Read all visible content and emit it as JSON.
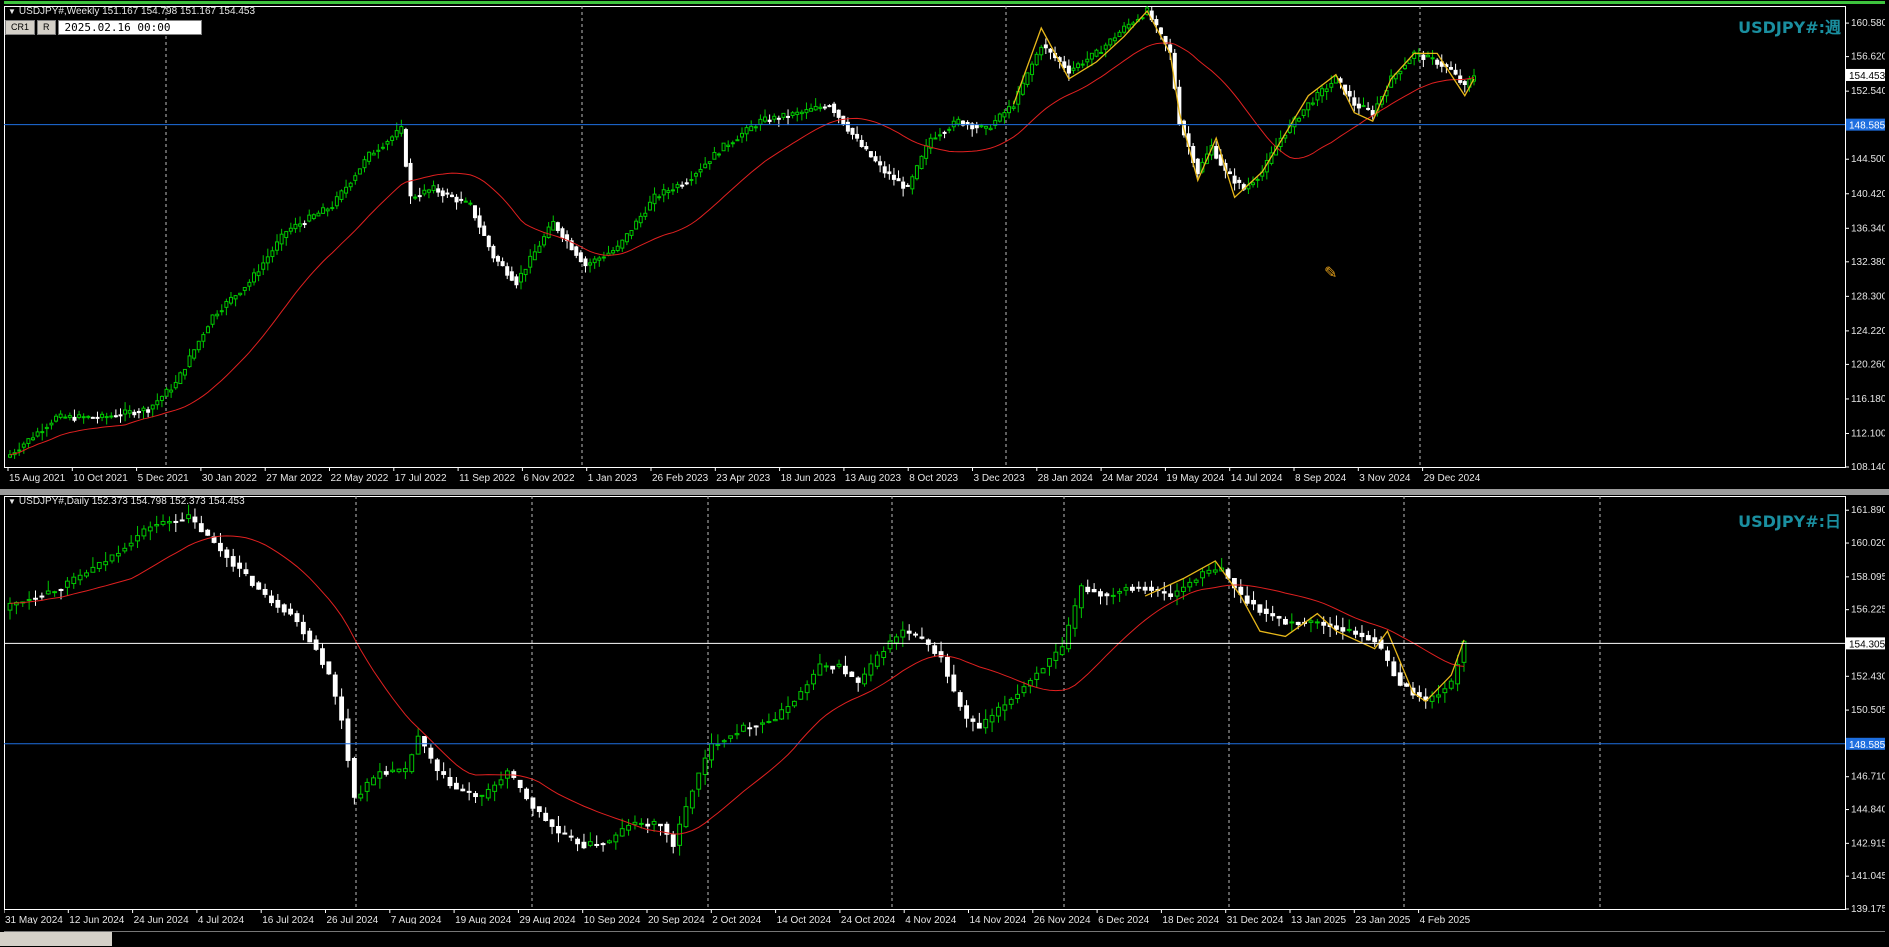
{
  "weekly": {
    "info": "USDJPY#,Weekly  151.167 154.798 151.167 154.453",
    "symbol_label": "USDJPY#:週",
    "toolbar": {
      "cr_button": "CR1",
      "r_button": "R",
      "date_value": "2025.02.16 00:00"
    },
    "price_current": "154.453",
    "price_line": "148.585",
    "colors": {
      "bull": "#000000",
      "bull_border": "#00ff00",
      "bear": "#ffffff",
      "ma": "#e02020",
      "zigzag": "#e8b81a",
      "hline": "#1e6fe0",
      "current": "#ffffff",
      "axis": "#ffffff"
    }
  },
  "daily": {
    "info": "USDJPY#,Daily  152.373 154.798 152.373 154.453",
    "symbol_label": "USDJPY#:日",
    "price_current": "154.305",
    "price_line": "148.585"
  },
  "chart_data": [
    {
      "type": "candlestick",
      "title": "USDJPY#,Weekly",
      "ylim": [
        108.14,
        162.6
      ],
      "y_ticks": [
        "160.580",
        "156.620",
        "152.540",
        "148.585",
        "144.500",
        "140.420",
        "136.340",
        "132.380",
        "128.300",
        "124.220",
        "120.260",
        "116.180",
        "112.100",
        "108.140"
      ],
      "x_labels": [
        "15 Aug 2021",
        "10 Oct 2021",
        "5 Dec 2021",
        "30 Jan 2022",
        "27 Mar 2022",
        "22 May 2022",
        "17 Jul 2022",
        "11 Sep 2022",
        "6 Nov 2022",
        "1 Jan 2023",
        "26 Feb 2023",
        "23 Apr 2023",
        "18 Jun 2023",
        "13 Aug 2023",
        "8 Oct 2023",
        "3 Dec 2023",
        "28 Jan 2024",
        "24 Mar 2024",
        "19 May 2024",
        "14 Jul 2024",
        "8 Sep 2024",
        "3 Nov 2024",
        "29 Dec 2024"
      ],
      "anchors": [
        [
          0,
          109.6
        ],
        [
          10,
          114
        ],
        [
          20,
          114
        ],
        [
          30,
          115
        ],
        [
          36,
          118
        ],
        [
          44,
          126
        ],
        [
          52,
          130
        ],
        [
          60,
          136
        ],
        [
          70,
          139
        ],
        [
          78,
          145
        ],
        [
          85,
          148
        ],
        [
          87,
          140
        ],
        [
          92,
          141
        ],
        [
          100,
          139
        ],
        [
          105,
          133
        ],
        [
          110,
          130
        ],
        [
          118,
          137
        ],
        [
          125,
          132
        ],
        [
          132,
          134
        ],
        [
          140,
          140
        ],
        [
          147,
          142
        ],
        [
          155,
          146
        ],
        [
          163,
          149
        ],
        [
          172,
          150
        ],
        [
          178,
          151
        ],
        [
          185,
          146
        ],
        [
          190,
          143
        ],
        [
          195,
          141
        ],
        [
          200,
          147
        ],
        [
          206,
          149
        ],
        [
          212,
          148
        ],
        [
          218,
          151
        ],
        [
          224,
          158
        ],
        [
          230,
          155
        ],
        [
          236,
          157
        ],
        [
          242,
          160
        ],
        [
          247,
          162
        ],
        [
          252,
          157
        ],
        [
          254,
          149
        ],
        [
          258,
          143
        ],
        [
          261,
          146
        ],
        [
          264,
          143
        ],
        [
          268,
          141
        ],
        [
          272,
          143
        ],
        [
          276,
          147
        ],
        [
          282,
          151
        ],
        [
          288,
          154
        ],
        [
          292,
          151
        ],
        [
          296,
          150
        ],
        [
          300,
          154
        ],
        [
          305,
          157
        ],
        [
          310,
          156
        ],
        [
          313,
          155
        ],
        [
          316,
          153
        ],
        [
          318,
          154.45
        ]
      ],
      "series": [
        {
          "name": "MA",
          "values": []
        },
        {
          "name": "ZigZag",
          "points": [
            [
              218,
              151
            ],
            [
              224,
              160
            ],
            [
              230,
              154
            ],
            [
              236,
              156
            ],
            [
              242,
              159
            ],
            [
              247,
              162
            ],
            [
              252,
              157
            ],
            [
              254,
              150
            ],
            [
              258,
              142
            ],
            [
              262,
              147
            ],
            [
              266,
              140
            ],
            [
              272,
              143
            ],
            [
              282,
              152
            ],
            [
              288,
              154.5
            ],
            [
              292,
              150
            ],
            [
              296,
              149
            ],
            [
              300,
              154
            ],
            [
              305,
              157
            ],
            [
              310,
              157
            ],
            [
              316,
              152
            ],
            [
              318,
              154
            ]
          ]
        }
      ],
      "hlines": [
        148.585,
        154.453
      ]
    },
    {
      "type": "candlestick",
      "title": "USDJPY#,Daily",
      "ylim": [
        139.175,
        162.7
      ],
      "y_ticks": [
        "161.890",
        "160.020",
        "158.095",
        "156.225",
        "154.305",
        "152.430",
        "150.505",
        "148.585",
        "146.710",
        "144.840",
        "142.915",
        "141.045",
        "139.175"
      ],
      "x_labels": [
        "31 May 2024",
        "12 Jun 2024",
        "24 Jun 2024",
        "4 Jul 2024",
        "16 Jul 2024",
        "26 Jul 2024",
        "7 Aug 2024",
        "19 Aug 2024",
        "29 Aug 2024",
        "10 Sep 2024",
        "20 Sep 2024",
        "2 Oct 2024",
        "14 Oct 2024",
        "24 Oct 2024",
        "4 Nov 2024",
        "14 Nov 2024",
        "26 Nov 2024",
        "6 Dec 2024",
        "18 Dec 2024",
        "31 Dec 2024",
        "13 Jan 2025",
        "23 Jan 2025",
        "4 Feb 2025"
      ],
      "anchors": [
        [
          0,
          156.5
        ],
        [
          8,
          157.5
        ],
        [
          15,
          159
        ],
        [
          22,
          161
        ],
        [
          28,
          161.5
        ],
        [
          32,
          160
        ],
        [
          36,
          158.5
        ],
        [
          40,
          157
        ],
        [
          44,
          156
        ],
        [
          48,
          154
        ],
        [
          50,
          152.5
        ],
        [
          52,
          150
        ],
        [
          54,
          145.5
        ],
        [
          58,
          147
        ],
        [
          62,
          147
        ],
        [
          64,
          149
        ],
        [
          67,
          147
        ],
        [
          70,
          146
        ],
        [
          74,
          145.5
        ],
        [
          78,
          147
        ],
        [
          82,
          145
        ],
        [
          86,
          143.5
        ],
        [
          90,
          142.8
        ],
        [
          94,
          143
        ],
        [
          97,
          144
        ],
        [
          102,
          144
        ],
        [
          104,
          142.8
        ],
        [
          107,
          146
        ],
        [
          110,
          148.5
        ],
        [
          115,
          149.5
        ],
        [
          120,
          150
        ],
        [
          124,
          151.5
        ],
        [
          127,
          153
        ],
        [
          130,
          153
        ],
        [
          133,
          152
        ],
        [
          137,
          154
        ],
        [
          140,
          155
        ],
        [
          143,
          154.5
        ],
        [
          146,
          153.5
        ],
        [
          148,
          151.5
        ],
        [
          150,
          150
        ],
        [
          152,
          149.5
        ],
        [
          155,
          150.5
        ],
        [
          158,
          151.5
        ],
        [
          162,
          153
        ],
        [
          165,
          154
        ],
        [
          168,
          157.5
        ],
        [
          172,
          157
        ],
        [
          175,
          157.5
        ],
        [
          178,
          157.5
        ],
        [
          182,
          157
        ],
        [
          187,
          158.3
        ],
        [
          190,
          158.5
        ],
        [
          193,
          157
        ],
        [
          197,
          156
        ],
        [
          200,
          155.5
        ],
        [
          205,
          155.5
        ],
        [
          210,
          155
        ],
        [
          214,
          154.5
        ],
        [
          218,
          152
        ],
        [
          222,
          151
        ],
        [
          226,
          152
        ],
        [
          228,
          154.45
        ]
      ],
      "series": [
        {
          "name": "MA",
          "values": []
        },
        {
          "name": "ZigZag",
          "points": [
            [
              178,
              157
            ],
            [
              184,
              158
            ],
            [
              189,
              159
            ],
            [
              193,
              157
            ],
            [
              196,
              155
            ],
            [
              200,
              154.7
            ],
            [
              205,
              156
            ],
            [
              208,
              155
            ],
            [
              214,
              154
            ],
            [
              216,
              155
            ],
            [
              220,
              151.5
            ],
            [
              222,
              151
            ],
            [
              226,
              152.5
            ],
            [
              228,
              154.5
            ]
          ]
        }
      ],
      "hlines": [
        148.585,
        154.305
      ]
    }
  ]
}
